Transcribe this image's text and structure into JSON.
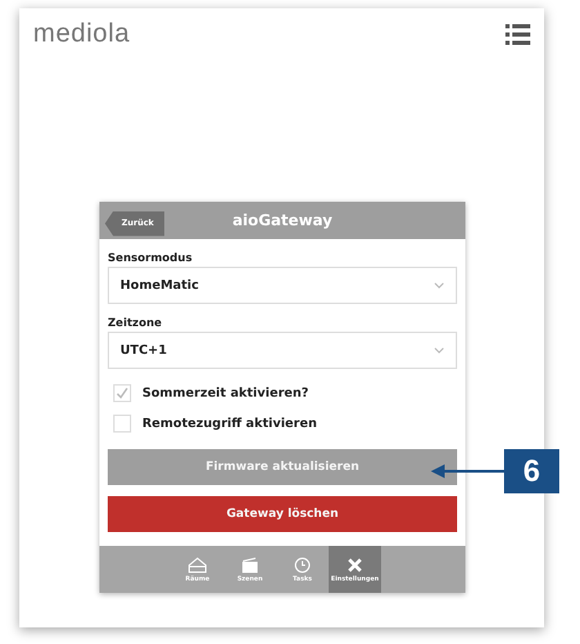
{
  "header": {
    "logo": "mediola"
  },
  "dialog": {
    "back": "Zurück",
    "title": "aioGateway",
    "fields": [
      {
        "label": "Sensormodus",
        "value": "HomeMatic"
      },
      {
        "label": "Zeitzone",
        "value": "UTC+1"
      }
    ],
    "checkboxes": [
      {
        "label": "Sommerzeit aktivieren?",
        "checked": true
      },
      {
        "label": "Remotezugriff aktivieren",
        "checked": false
      }
    ],
    "buttons": [
      {
        "label": "Firmware aktualisieren",
        "kind": "neutral"
      },
      {
        "label": "Gateway löschen",
        "kind": "danger"
      }
    ],
    "tabs": [
      {
        "label": "Räume",
        "kind": "rooms",
        "selected": false
      },
      {
        "label": "Szenen",
        "kind": "scenes",
        "selected": false
      },
      {
        "label": "Tasks",
        "kind": "tasks",
        "selected": false
      },
      {
        "label": "Einstellungen",
        "kind": "settings",
        "selected": true
      }
    ]
  },
  "callout": {
    "number": "6"
  }
}
